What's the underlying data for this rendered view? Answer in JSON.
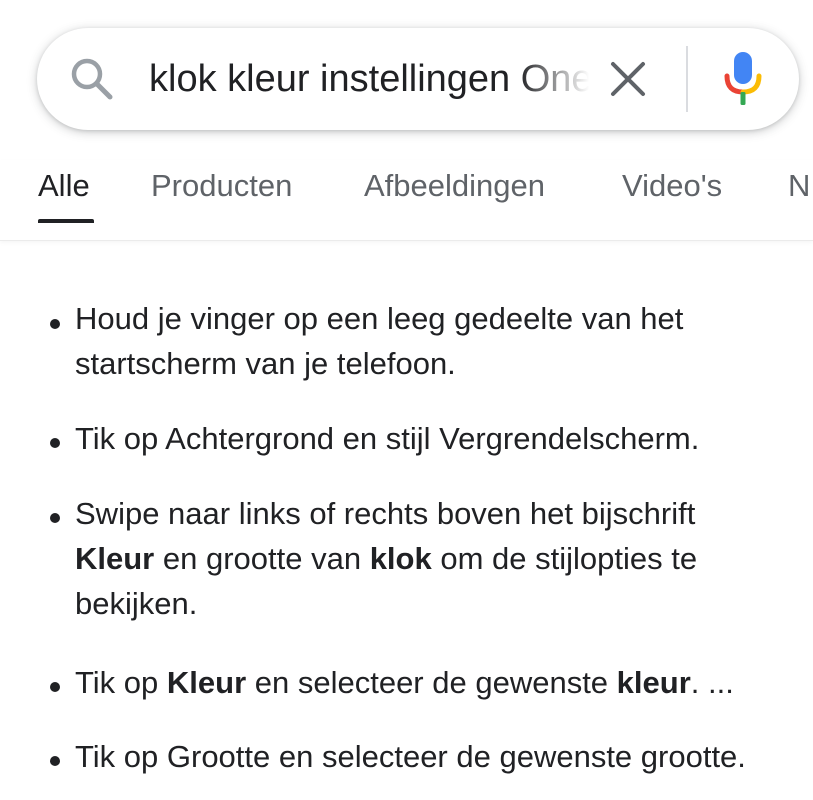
{
  "search": {
    "query": "klok kleur instellingen OnePlus",
    "placeholder": ""
  },
  "tabs": [
    {
      "label": "Alle",
      "active": true
    },
    {
      "label": "Producten",
      "active": false
    },
    {
      "label": "Afbeeldingen",
      "active": false
    },
    {
      "label": "Video's",
      "active": false
    },
    {
      "label": "N",
      "active": false
    }
  ],
  "steps": [
    {
      "line1": "Houd je vinger op een leeg gedeelte van het",
      "line2": "startscherm van je telefoon."
    },
    {
      "line1": "Tik op Achtergrond en stijl Vergrendelscherm."
    },
    {
      "p1": "Swipe naar links of rechts boven het bijschrift",
      "b1": "Kleur",
      "p2": " en grootte van ",
      "b2": "klok",
      "p3": " om de stijlopties te",
      "p4": "bekijken."
    },
    {
      "p1": "Tik op ",
      "b1": "Kleur",
      "p2": " en selecteer de gewenste ",
      "b2": "kleur",
      "p3": ". ..."
    },
    {
      "line1": "Tik op Grootte en selecteer de gewenste grootte."
    }
  ],
  "icons": {
    "search": "search-icon",
    "clear": "close-icon",
    "mic": "microphone-icon"
  },
  "colors": {
    "google_blue": "#4285F4",
    "google_red": "#EA4335",
    "google_yellow": "#FBBC05",
    "google_green": "#34A853",
    "text": "#202124",
    "muted": "#5f6368"
  }
}
